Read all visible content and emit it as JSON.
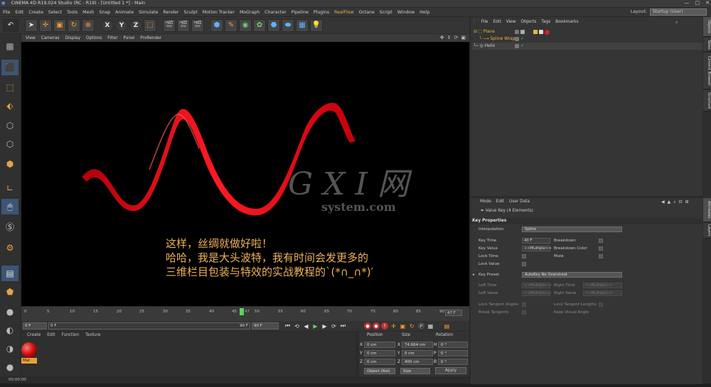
{
  "window": {
    "title": "CINEMA 4D R19.024 Studio (RC - R19) - [Untitled 1 *] - Main",
    "controls": [
      "—",
      "□",
      "✕"
    ]
  },
  "menubar": [
    "File",
    "Edit",
    "Create",
    "Select",
    "Tools",
    "Mesh",
    "Snap",
    "Animate",
    "Simulate",
    "Render",
    "Sculpt",
    "Motion Tracker",
    "MoGraph",
    "Character",
    "Pipeline",
    "Plugins",
    "RealFlow",
    "Octane",
    "Script",
    "Window",
    "Help"
  ],
  "layout": {
    "label": "Layout:",
    "value": "Startup (User)"
  },
  "toolbar": {
    "icons": [
      "undo-icon",
      "select-icon",
      "move-icon",
      "scale-icon",
      "rotate-icon",
      "recent-icon",
      "x-axis-icon",
      "y-axis-icon",
      "z-axis-icon",
      "coord-system-icon",
      "render-view-icon",
      "render-picture-queue-icon",
      "render-settings-icon",
      "cube-icon",
      "pen-icon",
      "subdivision-icon",
      "array-icon",
      "deformer-icon",
      "scene-floor-icon",
      "camera-icon",
      "light-icon"
    ],
    "xyz": [
      "X",
      "Y",
      "Z"
    ]
  },
  "viewport": {
    "menu": [
      "View",
      "Cameras",
      "Display",
      "Options",
      "Filter",
      "Panel",
      "ProRender"
    ],
    "subtitle": "这样，丝绸就做好啦！\n哈哈，我是大头波特，我有时间会发更多的\n三维栏目包装与特效的实战教程的`(*∩_∩*)′",
    "watermark": {
      "big": "G X I 网",
      "small": "system.com"
    },
    "ribbon_color": "#e0141c"
  },
  "timeline": {
    "ticks": [
      "0",
      "5",
      "10",
      "15",
      "20",
      "25",
      "30",
      "35",
      "40",
      "45",
      "47",
      "50",
      "55",
      "60",
      "65",
      "70",
      "75",
      "80",
      "85",
      "90"
    ],
    "current": "47",
    "end": "47 F"
  },
  "transport": {
    "start": "0 F",
    "current": "0 F",
    "end_a": "90 F",
    "end_b": "90 F"
  },
  "material_manager": {
    "menu": [
      "Create",
      "Edit",
      "Function",
      "Texture"
    ],
    "materials": [
      {
        "name": "Mat",
        "color": "#d11010"
      }
    ]
  },
  "coordinates": {
    "headers": [
      "Position",
      "Size",
      "Rotation"
    ],
    "rows": [
      {
        "axis": "X",
        "pos": "0 cm",
        "size_axis": "X",
        "size": "74.664 cm",
        "rot_axis": "H",
        "rot": "0 °"
      },
      {
        "axis": "Y",
        "pos": "0 cm",
        "size_axis": "Y",
        "size": "0 cm",
        "rot_axis": "P",
        "rot": "0 °"
      },
      {
        "axis": "Z",
        "pos": "0 cm",
        "size_axis": "Z",
        "size": "400 cm",
        "rot_axis": "B",
        "rot": "0 °"
      }
    ],
    "mode": "Object (Rel)",
    "size_mode": "Size",
    "apply": "Apply"
  },
  "status": {
    "time": "00:00:00"
  },
  "object_manager": {
    "menu": [
      "File",
      "Edit",
      "View",
      "Objects",
      "Tags",
      "Bookmarks"
    ],
    "objects": [
      {
        "name": "Plane",
        "indent": 0,
        "color": "#e7b64a"
      },
      {
        "name": "Spline Wrap",
        "indent": 1,
        "color": "#e7b64a"
      },
      {
        "name": "Helix",
        "indent": 1,
        "color": "#cfcfcf"
      }
    ]
  },
  "attribute_manager": {
    "menu": [
      "Mode",
      "Edit",
      "User Data"
    ],
    "title": "Value Key (4 Elements)",
    "section": "Key Properties",
    "interpolation": {
      "label": "Interpolation",
      "value": "Spline"
    },
    "key_time": {
      "label": "Key Time",
      "value": "40 F"
    },
    "key_value": {
      "label": "Key Value",
      "value": "<<Multiple>>"
    },
    "lock_time": "Lock Time",
    "mute": "Mute",
    "lock_value": "Lock Value",
    "breakdown": "Breakdown",
    "breakdown_color": "Breakdown Color",
    "key_preset": {
      "label": "Key Preset",
      "value": "AutoKey No Overshoot"
    },
    "left_time": {
      "label": "Left Time",
      "value": "<<Multiple>>"
    },
    "right_time": {
      "label": "Right Time",
      "value": "<<Multiple>>"
    },
    "left_value": {
      "label": "Left Value",
      "value": "<<Multiple>>"
    },
    "right_value": {
      "label": "Right Value",
      "value": "<<Multiple>>"
    },
    "lock_tangent_angles": "Lock Tangent Angles",
    "lock_tangent_lengths": "Lock Tangent Lengths",
    "break_tangents": "Break Tangents",
    "keep_visual_angle": "Keep Visual Angle"
  },
  "right_tabs": [
    "Objects",
    "Takes",
    "Content Browser",
    "Structure",
    "Attributes",
    "Layers"
  ]
}
